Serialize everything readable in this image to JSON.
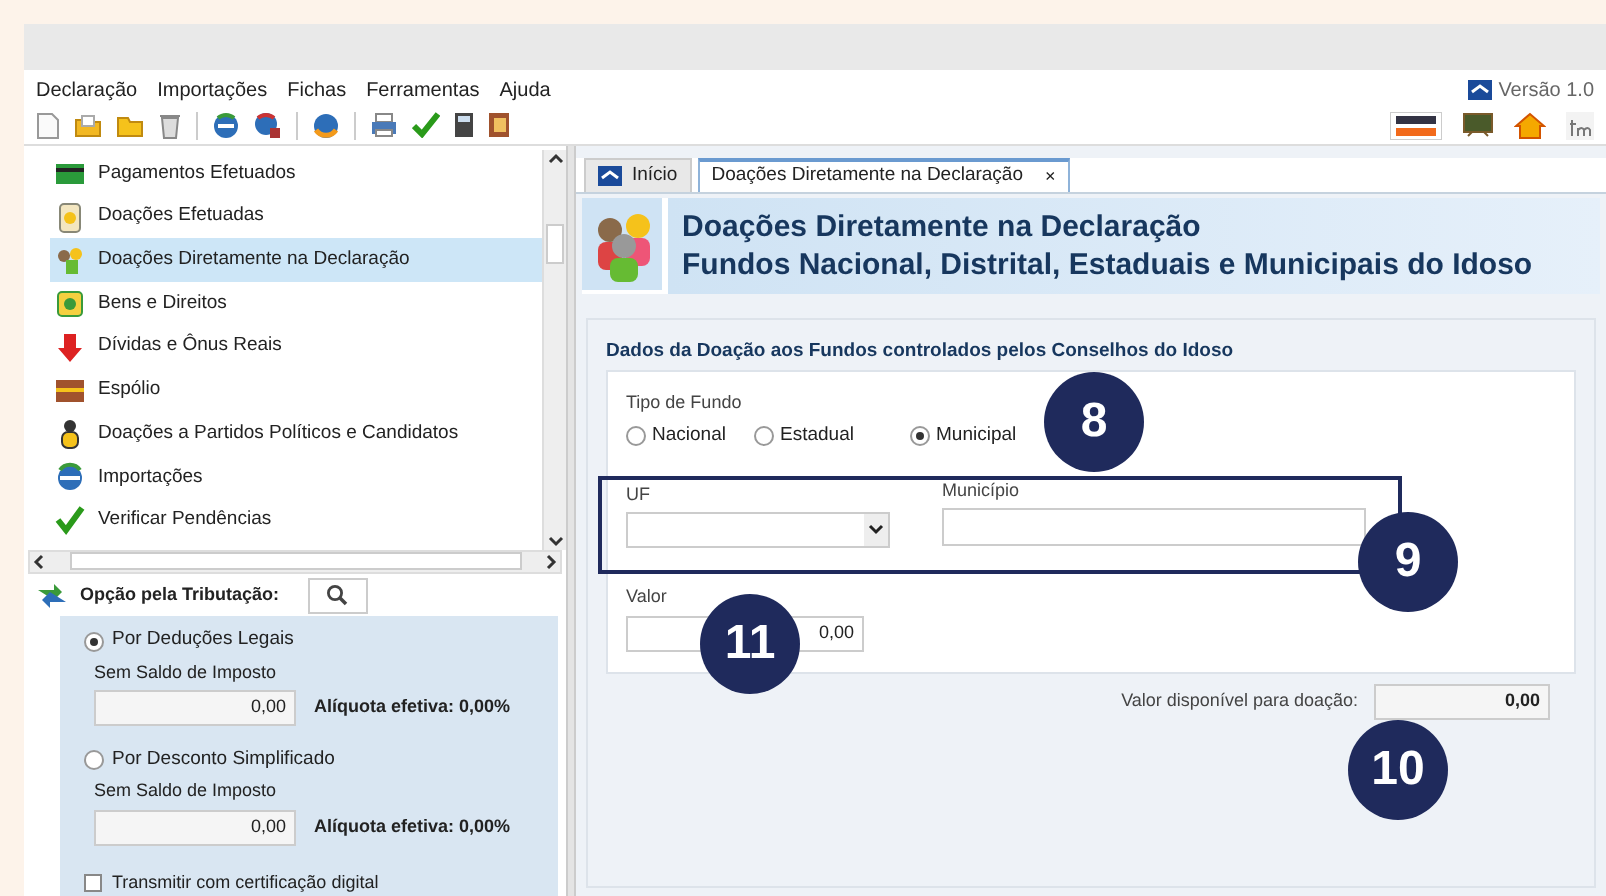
{
  "app": {
    "version": "Versão 1.0"
  },
  "menu": [
    "Declaração",
    "Importações",
    "Fichas",
    "Ferramentas",
    "Ajuda"
  ],
  "sidebar": {
    "items": [
      {
        "label": "Pagamentos Efetuados",
        "selected": false
      },
      {
        "label": "Doações Efetuadas",
        "selected": false
      },
      {
        "label": "Doações Diretamente na Declaração",
        "selected": true
      },
      {
        "label": "Bens e Direitos",
        "selected": false
      },
      {
        "label": "Dívidas e Ônus Reais",
        "selected": false
      },
      {
        "label": "Espólio",
        "selected": false
      },
      {
        "label": "Doações a Partidos Políticos e Candidatos",
        "selected": false
      },
      {
        "label": "Importações",
        "selected": false
      },
      {
        "label": "Verificar Pendências",
        "selected": false
      }
    ]
  },
  "tributacao": {
    "label": "Opção pela Tributação:",
    "options": [
      {
        "label": "Por Deduções Legais",
        "selected": true,
        "sublabel": "Sem Saldo de Imposto",
        "value": "0,00",
        "rate": "Alíquota efetiva: 0,00%"
      },
      {
        "label": "Por Desconto Simplificado",
        "selected": false,
        "sublabel": "Sem Saldo de Imposto",
        "value": "0,00",
        "rate": "Alíquota efetiva: 0,00%"
      }
    ],
    "certification": {
      "label": "Transmitir com certificação digital",
      "checked": false
    }
  },
  "tabs": [
    {
      "label": "Início",
      "selected": false
    },
    {
      "label": "Doações Diretamente na Declaração",
      "selected": true,
      "close": "×"
    }
  ],
  "header": {
    "title": "Doações Diretamente na Declaração",
    "subtitle": "Fundos Nacional, Distrital, Estaduais e Municipais do Idoso"
  },
  "form": {
    "section_title": "Dados da Doação aos Fundos controlados pelos Conselhos do Idoso",
    "fund_type": {
      "label": "Tipo de Fundo",
      "options": [
        {
          "label": "Nacional",
          "selected": false
        },
        {
          "label": "Estadual",
          "selected": false
        },
        {
          "label": "Municipal",
          "selected": true
        }
      ]
    },
    "uf": {
      "label": "UF"
    },
    "municipio": {
      "label": "Município"
    },
    "valor": {
      "label": "Valor",
      "value": "0,00"
    },
    "available": {
      "label": "Valor disponível para doação:",
      "value": "0,00"
    }
  },
  "callouts": [
    "8",
    "9",
    "10",
    "11"
  ]
}
